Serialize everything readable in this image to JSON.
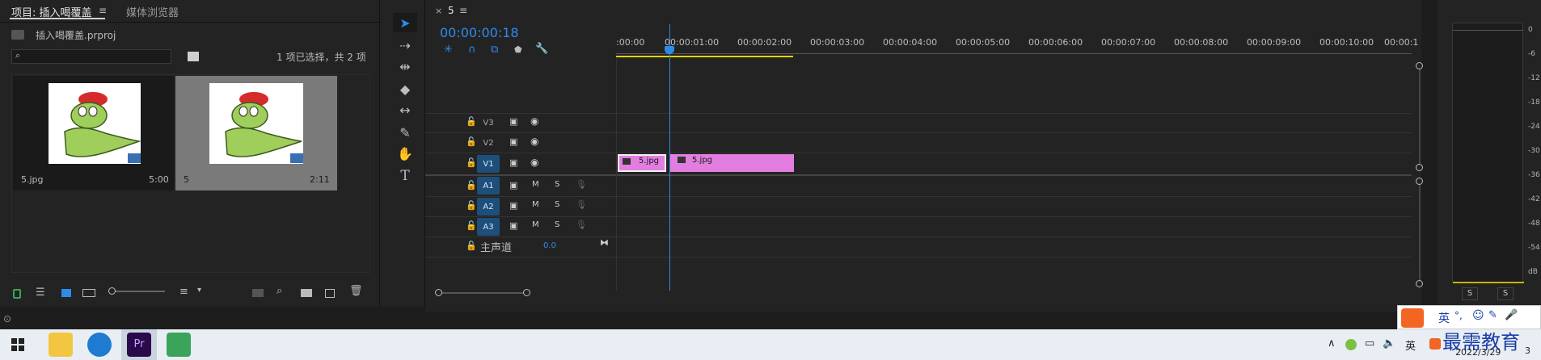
{
  "project": {
    "tabs": [
      "项目: 插入喝覆盖",
      "媒体浏览器"
    ],
    "file_name": "插入喝覆盖.prproj",
    "search_placeholder": "",
    "selection_info": "1 项已选择，共 2 项",
    "items": [
      {
        "name": "5.jpg",
        "duration": "5:00"
      },
      {
        "name": "5",
        "duration": "2:11"
      }
    ]
  },
  "timeline": {
    "tab_close": "×",
    "sequence_name": "5",
    "menu_glyph": "≡",
    "timecode": "00:00:00:18",
    "ruler": [
      ":00:00",
      "00:00:01:00",
      "00:00:02:00",
      "00:00:03:00",
      "00:00:04:00",
      "00:00:05:00",
      "00:00:06:00",
      "00:00:07:00",
      "00:00:08:00",
      "00:00:09:00",
      "00:00:10:00",
      "00:00:1"
    ],
    "video_tracks": [
      "V3",
      "V2",
      "V1"
    ],
    "audio_tracks": [
      "A1",
      "A2",
      "A3"
    ],
    "mute_label": "M",
    "solo_label": "S",
    "master_label": "主声道",
    "master_value": "0.0",
    "clips": [
      "5.jpg",
      "5.jpg"
    ]
  },
  "meters": {
    "db_labels": [
      "0",
      "-6",
      "-12",
      "-18",
      "-24",
      "-30",
      "-36",
      "-42",
      "-48",
      "-54",
      "dB"
    ],
    "solo_buttons": [
      "S",
      "S"
    ]
  },
  "taskbar": {
    "date": "2022/3/29",
    "ime_label": "英",
    "watermark": "最需教育",
    "notif_count": "3"
  },
  "colors": {
    "accent_blue": "#2d8ceb",
    "clip_pink": "#e27ee0",
    "selected_track": "#1e4f7a",
    "work_area": "#e6d200"
  }
}
